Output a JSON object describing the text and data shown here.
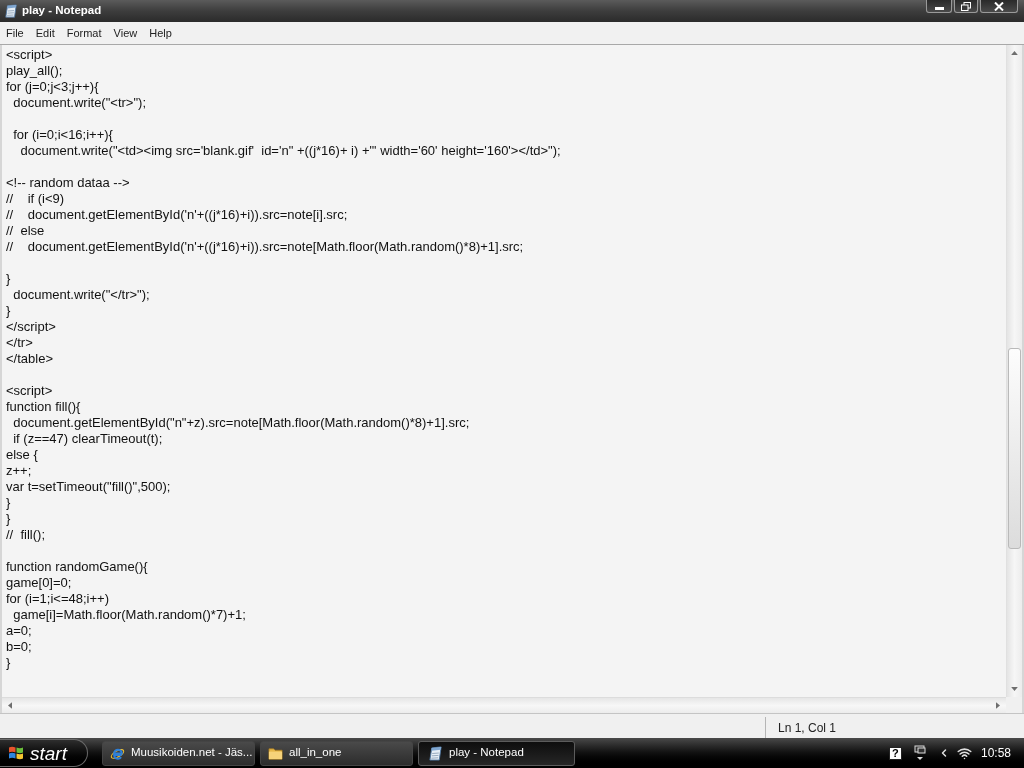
{
  "window": {
    "title": "play - Notepad"
  },
  "menu": [
    "File",
    "Edit",
    "Format",
    "View",
    "Help"
  ],
  "editor": {
    "blocks": [
      [
        "<script>",
        "play_all();",
        "for (j=0;j<3;j++){",
        "  document.write(\"<tr>\");"
      ],
      [
        "  for (i=0;i<16;i++){",
        "    document.write(\"<td><img src='blank.gif'  id='n\" +((j*16)+ i) +\"' width='60' height='160'></td>\");"
      ],
      [
        "<!-- random dataa -->",
        "//    if (i<9)",
        "//    document.getElementById('n'+((j*16)+i)).src=note[i].src;",
        "//  else",
        "//    document.getElementById('n'+((j*16)+i)).src=note[Math.floor(Math.random()*8)+1].src;"
      ],
      [
        "}",
        "  document.write(\"</tr>\");",
        "}",
        "</script>",
        "</tr>",
        "</table>"
      ],
      [
        "<script>",
        "function fill(){",
        "  document.getElementById(\"n\"+z).src=note[Math.floor(Math.random()*8)+1].src;",
        "  if (z==47) clearTimeout(t);",
        "else {",
        "z++;",
        "var t=setTimeout(\"fill()\",500);",
        "}",
        "}",
        "//  fill();"
      ],
      [
        "function randomGame(){",
        "game[0]=0;",
        "for (i=1;i<=48;i++)",
        "  game[i]=Math.floor(Math.random()*7)+1;",
        "a=0;",
        "b=0;",
        "}"
      ]
    ]
  },
  "status_bar": {
    "position": "Ln 1, Col 1"
  },
  "taskbar": {
    "start": "start",
    "tasks": [
      {
        "label": "Muusikoiden.net - Jäs...",
        "kind": "browser",
        "selected": false
      },
      {
        "label": "all_in_one",
        "kind": "folder",
        "selected": false
      },
      {
        "label": "play - Notepad",
        "kind": "notepad",
        "selected": true
      }
    ],
    "help_glyph": "?",
    "clock": "10:58"
  }
}
